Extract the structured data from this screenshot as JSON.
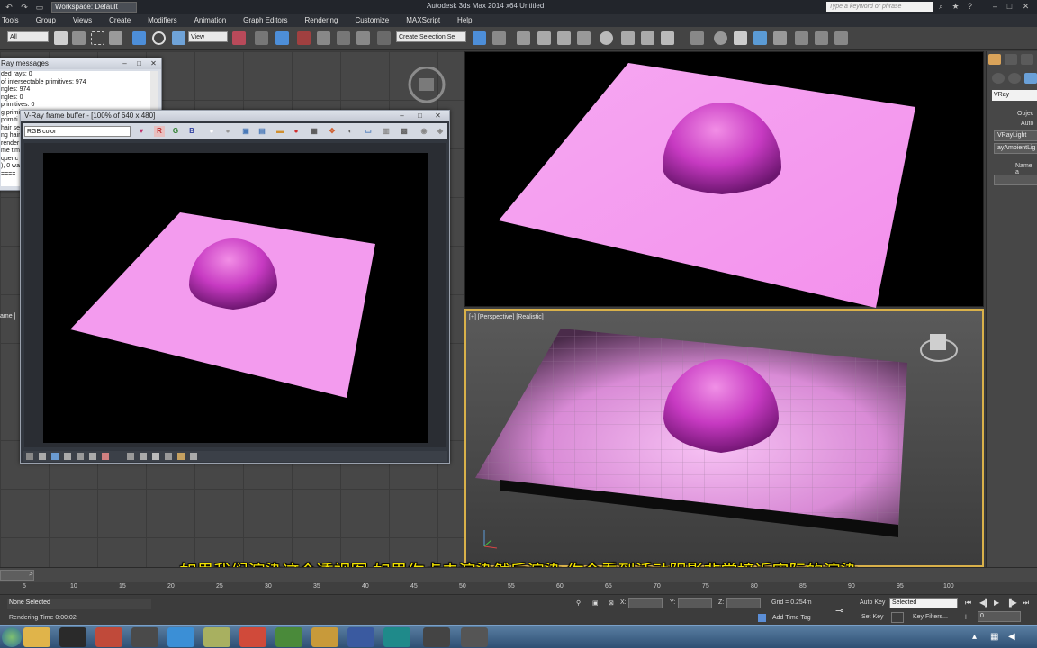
{
  "titlebar": {
    "workspace": "Workspace: Default",
    "app_title": "Autodesk 3ds Max  2014 x64      Untitled",
    "search_placeholder": "Type a keyword or phrase"
  },
  "menu": [
    "Tools",
    "Group",
    "Views",
    "Create",
    "Modifiers",
    "Animation",
    "Graph Editors",
    "Rendering",
    "Customize",
    "MAXScript",
    "Help"
  ],
  "toolbar": {
    "selection_filter": "All",
    "reference_coord": "View",
    "named_selection": "Create Selection Se"
  },
  "vray_messages": {
    "title": "Ray messages",
    "lines": [
      "ded rays: 0",
      "of intersectable primitives: 974",
      "ngles: 974",
      "ngles: 0",
      "primitives: 0",
      "g primit",
      "primiti",
      "hair se",
      "ng hair s",
      "render",
      "me tim",
      "quenc",
      "), 0 wa",
      "===="
    ]
  },
  "vfb": {
    "title": "V-Ray frame buffer - [100% of 640 x 480]",
    "channel": "RGB color",
    "r": "R",
    "g": "G",
    "b": "B"
  },
  "viewports": {
    "perspective_label": "[+] [Perspective] [Realistic]",
    "left_label": "ame ]"
  },
  "command_panel": {
    "renderer": "VRay",
    "object_type": "Objec",
    "auto_grid": "Auto",
    "btn1": "VRayLight",
    "btn2": "ayAmbientLig",
    "name_rollout": "Name a"
  },
  "subtitle": "如果我们渲染这个透视图 如果你点击渲染然后渲染 你会看到活动阴影非常接近实际的渲染",
  "timeline": {
    "slider_label": "0 / 100",
    "ticks": [
      "5",
      "10",
      "15",
      "20",
      "25",
      "30",
      "35",
      "40",
      "45",
      "50",
      "55",
      "60",
      "65",
      "70",
      "75",
      "80",
      "85",
      "90",
      "95",
      "100"
    ]
  },
  "status": {
    "selection": "None Selected",
    "rendering_time": "Rendering Time  0:00:02",
    "x_label": "X:",
    "y_label": "Y:",
    "z_label": "Z:",
    "grid": "Grid = 0.254m",
    "add_time_tag": "Add Time Tag",
    "auto_key": "Auto Key",
    "selected": "Selected",
    "set_key": "Set Key",
    "key_filters": "Key Filters...",
    "frame": "0"
  },
  "colors": {
    "plane": "#f39bf0",
    "sphere": "#c93fc4",
    "active_border": "#d9b14a",
    "subtitle": "#f4e400"
  }
}
